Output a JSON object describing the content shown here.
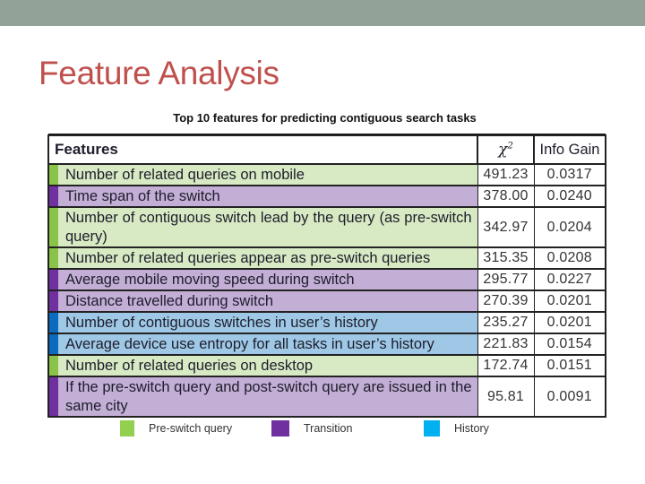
{
  "slide": {
    "title": "Feature Analysis"
  },
  "table": {
    "caption": "Top 10 features for predicting contiguous search tasks",
    "headers": {
      "features": "Features",
      "chi_base": "χ",
      "chi_sup": "2",
      "info_gain": "Info Gain"
    },
    "rows": [
      {
        "feature": "Number of related queries on mobile",
        "chi2": "491.23",
        "info_gain": "0.0317",
        "category": "pre-switch"
      },
      {
        "feature": "Time span of the switch",
        "chi2": "378.00",
        "info_gain": "0.0240",
        "category": "transition"
      },
      {
        "feature": "Number of contiguous switch lead by the query (as pre-switch query)",
        "chi2": "342.97",
        "info_gain": "0.0204",
        "category": "pre-switch"
      },
      {
        "feature": "Number of related queries appear as pre-switch queries",
        "chi2": "315.35",
        "info_gain": "0.0208",
        "category": "pre-switch"
      },
      {
        "feature": "Average mobile moving speed during switch",
        "chi2": "295.77",
        "info_gain": "0.0227",
        "category": "transition"
      },
      {
        "feature": "Distance travelled during switch",
        "chi2": "270.39",
        "info_gain": "0.0201",
        "category": "transition"
      },
      {
        "feature": "Number of contiguous switches in user’s history",
        "chi2": "235.27",
        "info_gain": "0.0201",
        "category": "history"
      },
      {
        "feature": "Average device use entropy for all tasks in user’s history",
        "chi2": "221.83",
        "info_gain": "0.0154",
        "category": "history"
      },
      {
        "feature": "Number of related queries on desktop",
        "chi2": "172.74",
        "info_gain": "0.0151",
        "category": "pre-switch"
      },
      {
        "feature": "If the pre-switch query and post-switch query are issued in the same city",
        "chi2": "95.81",
        "info_gain": "0.0091",
        "category": "transition"
      }
    ]
  },
  "legend": [
    {
      "label": "Pre-switch query",
      "color": "#92d050"
    },
    {
      "label": "Transition",
      "color": "#7030a0"
    },
    {
      "label": "History",
      "color": "#00b0f0"
    }
  ],
  "colors": {
    "title": "#c0504d",
    "top_bar": "#93a299",
    "pre_switch_bar": "#8bc34a",
    "pre_switch_fill": "#d8eac3",
    "transition_bar": "#7030a0",
    "transition_fill": "#c3aed6",
    "history_bar": "#0a6bc0",
    "history_fill": "#9fc8e6"
  }
}
